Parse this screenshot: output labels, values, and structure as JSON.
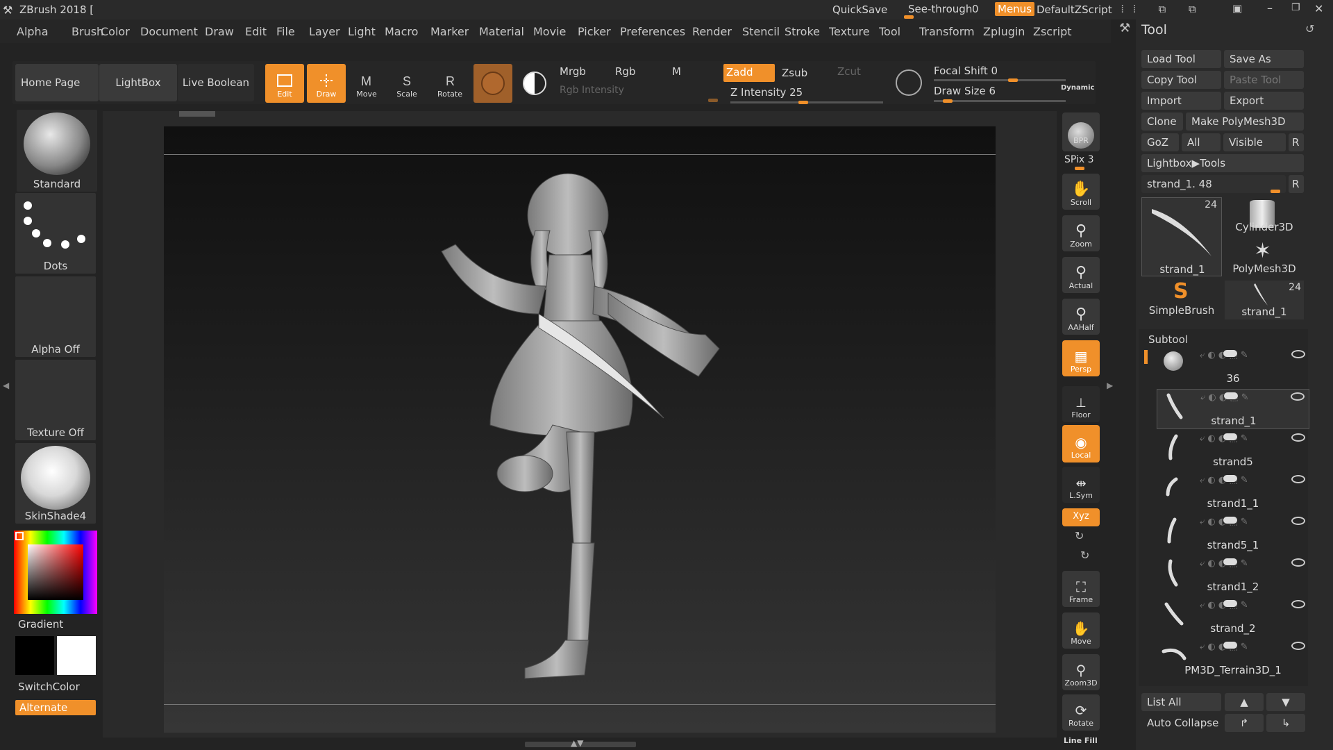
{
  "titlebar": {
    "app": "ZBrush 2018 [",
    "quicksave": "QuickSave",
    "seethrough": "See-through",
    "seethrough_val": "0",
    "menus": "Menus",
    "script": "DefaultZScript"
  },
  "menus": [
    "Alpha",
    "Brush",
    "Color",
    "Document",
    "Draw",
    "Edit",
    "File",
    "Layer",
    "Light",
    "Macro",
    "Marker",
    "Material",
    "Movie",
    "Picker",
    "Preferences",
    "Render",
    "Stencil",
    "Stroke",
    "Texture",
    "Tool",
    "Transform",
    "Zplugin",
    "Zscript"
  ],
  "toolbar": {
    "home": "Home Page",
    "lightbox": "LightBox",
    "liveboolean": "Live Boolean",
    "edit": "Edit",
    "draw": "Draw",
    "move": "Move",
    "scale": "Scale",
    "rotate": "Rotate",
    "mrgb": "Mrgb",
    "rgb": "Rgb",
    "m": "M",
    "zadd": "Zadd",
    "zsub": "Zsub",
    "zcut": "Zcut",
    "rgb_intensity": "Rgb Intensity",
    "z_intensity": "Z Intensity 25",
    "focal_shift": "Focal Shift 0",
    "draw_size": "Draw Size 6",
    "dynamic": "Dynamic"
  },
  "left": {
    "brush": "Standard",
    "stroke": "Dots",
    "alpha": "Alpha Off",
    "texture": "Texture Off",
    "material": "SkinShade4",
    "gradient": "Gradient",
    "switchcolor": "SwitchColor",
    "alternate": "Alternate"
  },
  "rightshelf": {
    "bpr": "BPR",
    "spix": "SPix 3",
    "scroll": "Scroll",
    "zoom": "Zoom",
    "actual": "Actual",
    "aahalf": "AAHalf",
    "persp": "Persp",
    "floor": "Floor",
    "local": "Local",
    "lsym": "L.Sym",
    "xyz": "Xyz",
    "frame": "Frame",
    "move": "Move",
    "zoom3d": "Zoom3D",
    "rotate": "Rotate",
    "linefill": "Line Fill"
  },
  "tool": {
    "title": "Tool",
    "load": "Load Tool",
    "saveas": "Save As",
    "copy": "Copy Tool",
    "paste": "Paste Tool",
    "import": "Import",
    "export": "Export",
    "clone": "Clone",
    "makepoly": "Make PolyMesh3D",
    "goz": "GoZ",
    "all": "All",
    "visible": "Visible",
    "r": "R",
    "lightbox_tools": "Lightbox▶Tools",
    "current": "strand_1. 48",
    "thumbs": [
      {
        "name": "strand_1",
        "count": "24"
      },
      {
        "name": "Cylinder3D",
        "count": ""
      },
      {
        "name": "PolyMesh3D",
        "count": ""
      },
      {
        "name": "SimpleBrush",
        "count": ""
      },
      {
        "name": "strand_1",
        "count": "24"
      }
    ]
  },
  "subtool": {
    "title": "Subtool",
    "first_count": "36",
    "items": [
      "strand_1",
      "strand5",
      "strand1_1",
      "strand5_1",
      "strand1_2",
      "strand_2",
      "PM3D_Terrain3D_1"
    ],
    "listall": "List All",
    "autocollapse": "Auto Collapse"
  }
}
